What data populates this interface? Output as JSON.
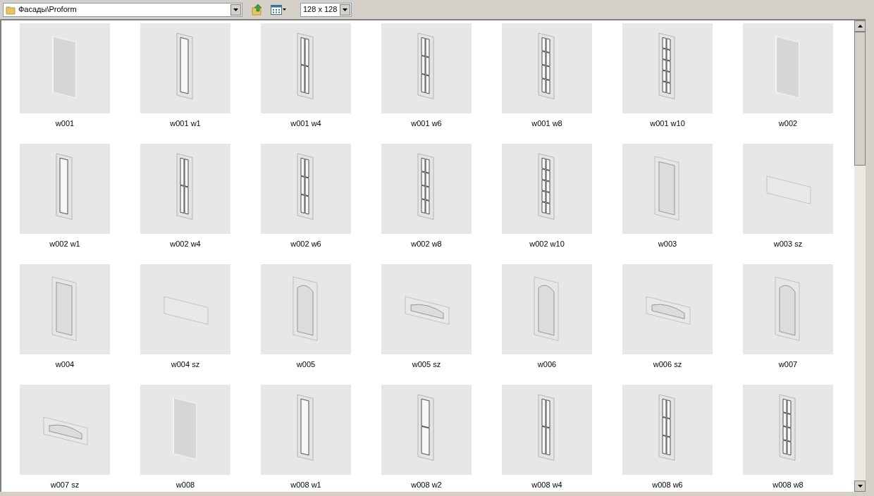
{
  "toolbar": {
    "path": "Фасады\\Proform",
    "size": "128 x 128"
  },
  "items": [
    {
      "label": "w001",
      "kind": "slab"
    },
    {
      "label": "w001 w1",
      "kind": "glass1"
    },
    {
      "label": "w001 w4",
      "kind": "glass4"
    },
    {
      "label": "w001 w6",
      "kind": "glass6"
    },
    {
      "label": "w001 w8",
      "kind": "glass8"
    },
    {
      "label": "w001 w10",
      "kind": "glass10"
    },
    {
      "label": "w002",
      "kind": "slab"
    },
    {
      "label": "w002 w1",
      "kind": "glass1"
    },
    {
      "label": "w002 w4",
      "kind": "glass4"
    },
    {
      "label": "w002 w6",
      "kind": "glass6"
    },
    {
      "label": "w002 w8",
      "kind": "glass8"
    },
    {
      "label": "w002 w10",
      "kind": "glass10"
    },
    {
      "label": "w003",
      "kind": "panel"
    },
    {
      "label": "w003 sz",
      "kind": "wide"
    },
    {
      "label": "w004",
      "kind": "panel"
    },
    {
      "label": "w004 sz",
      "kind": "wide"
    },
    {
      "label": "w005",
      "kind": "arched"
    },
    {
      "label": "w005 sz",
      "kind": "arched-wide"
    },
    {
      "label": "w006",
      "kind": "arched"
    },
    {
      "label": "w006 sz",
      "kind": "arched-wide"
    },
    {
      "label": "w007",
      "kind": "arched"
    },
    {
      "label": "w007 sz",
      "kind": "arched-wide"
    },
    {
      "label": "w008",
      "kind": "slab"
    },
    {
      "label": "w008 w1",
      "kind": "glass1"
    },
    {
      "label": "w008 w2",
      "kind": "glass2"
    },
    {
      "label": "w008 w4",
      "kind": "glass4"
    },
    {
      "label": "w008 w6",
      "kind": "glass6"
    },
    {
      "label": "w008 w8",
      "kind": "glass8"
    }
  ]
}
